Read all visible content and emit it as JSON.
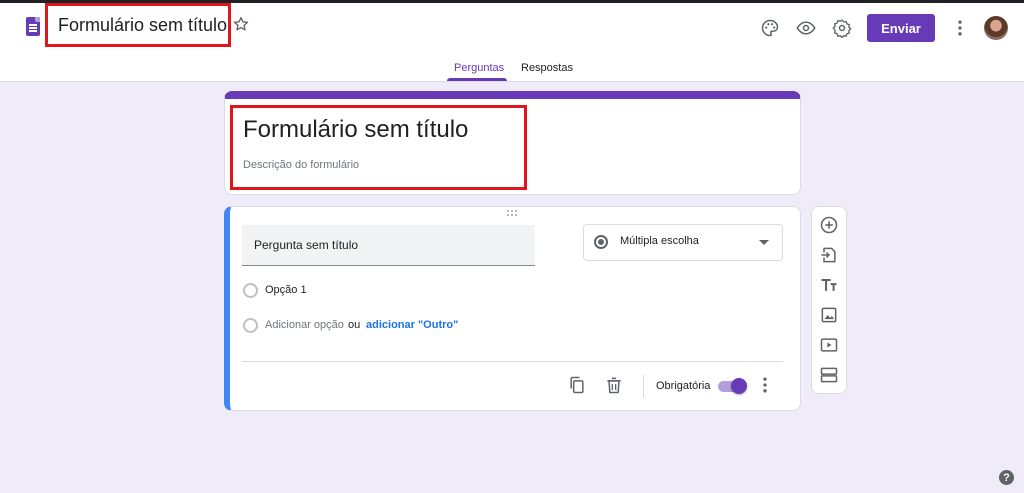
{
  "header": {
    "doc_title": "Formulário sem título",
    "send_label": "Enviar",
    "icons": [
      "forms-logo-icon",
      "star-icon",
      "palette-icon",
      "eye-icon",
      "gear-icon",
      "more-vert-icon"
    ]
  },
  "tabs": [
    {
      "label": "Perguntas",
      "active": true
    },
    {
      "label": "Respostas",
      "active": false
    }
  ],
  "form": {
    "title": "Formulário sem título",
    "description": "Descrição do formulário"
  },
  "question": {
    "title": "Pergunta sem título",
    "type": "Múltipla escolha",
    "options": [
      {
        "label": "Opção 1"
      }
    ],
    "add_option": "Adicionar opção",
    "or_text": "ou",
    "add_other": "adicionar \"Outro\"",
    "required_label": "Obrigatória",
    "required": true
  },
  "side_toolbar": [
    "add-question-icon",
    "import-questions-icon",
    "title-text-icon",
    "image-icon",
    "video-icon",
    "section-icon"
  ],
  "colors": {
    "brand": "#673ab7",
    "brand_light": "#b39ddb",
    "background": "#f0ebf8",
    "active_question": "#4285f4",
    "link": "#1a73e8",
    "highlight": "#e0161f"
  }
}
